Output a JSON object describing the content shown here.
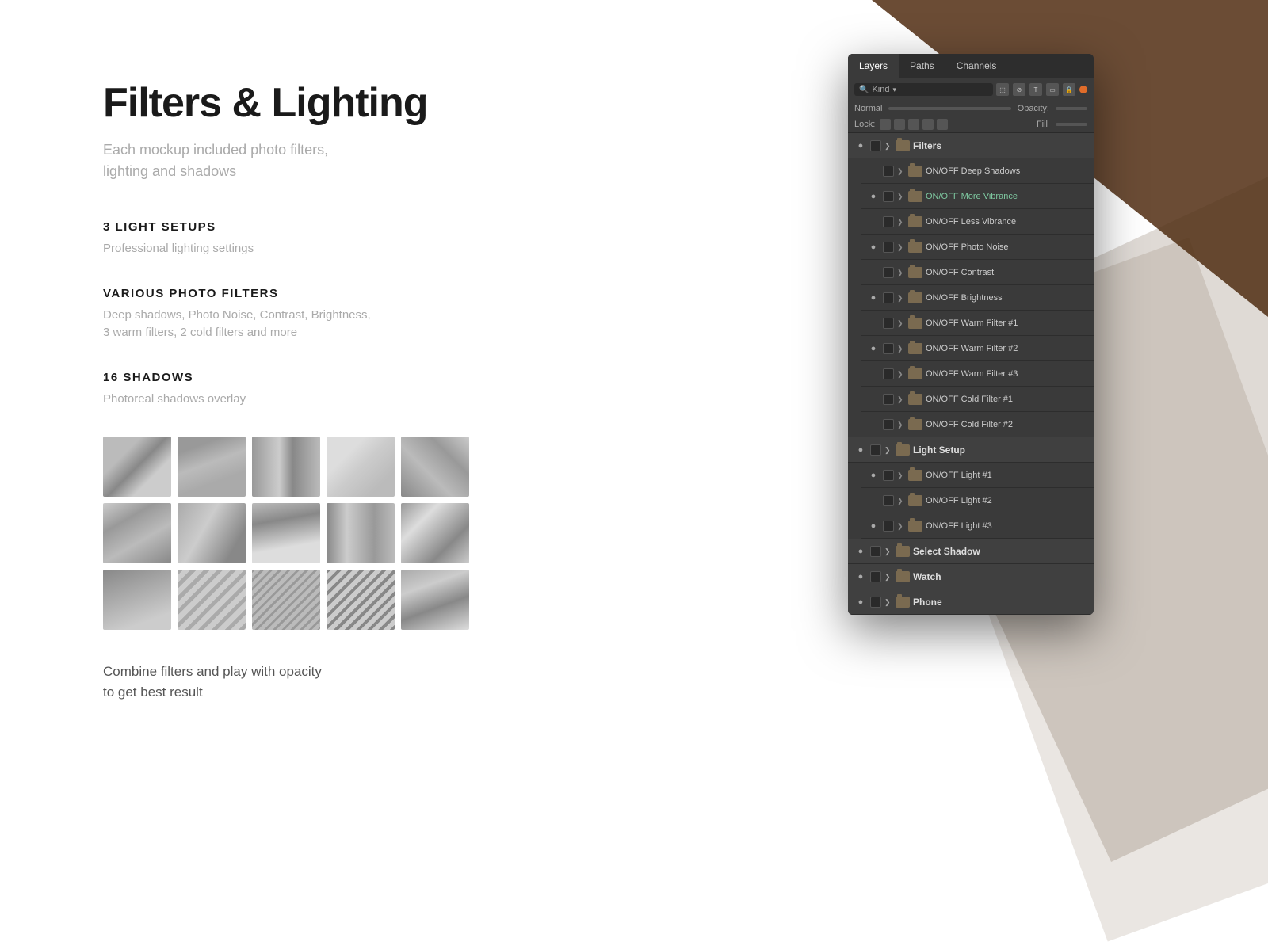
{
  "background": {
    "corner_color": "#6b4c35"
  },
  "left_content": {
    "title": "Filters & Lighting",
    "subtitle_line1": "Each mockup included photo filters,",
    "subtitle_line2": "lighting and shadows",
    "sections": [
      {
        "id": "light-setups",
        "title": "3 LIGHT SETUPS",
        "description": "Professional lighting settings"
      },
      {
        "id": "photo-filters",
        "title": "VARIOUS PHOTO FILTERS",
        "description_line1": "Deep shadows, Photo Noise, Contrast, Brightness,",
        "description_line2": "3 warm filters, 2 cold filters and more"
      },
      {
        "id": "shadows",
        "title": "16 SHADOWS",
        "description": "Photoreal shadows overlay"
      }
    ],
    "bottom_text_line1": "Combine filters and play with opacity",
    "bottom_text_line2": "to get best result"
  },
  "ps_panel": {
    "tabs": [
      "Layers",
      "Paths",
      "Channels"
    ],
    "active_tab": "Layers",
    "search_placeholder": "Kind",
    "blend_mode": "Normal",
    "opacity_label": "Opacity:",
    "lock_label": "Lock:",
    "fill_label": "Fill",
    "layers": [
      {
        "id": "filters-group",
        "type": "group",
        "visible": true,
        "expanded": true,
        "name": "Filters",
        "indent": 0
      },
      {
        "id": "deep-shadows",
        "type": "layer",
        "visible": false,
        "name": "ON/OFF Deep Shadows",
        "indent": 1
      },
      {
        "id": "more-vibrance",
        "type": "layer",
        "visible": true,
        "name": "ON/OFF More Vibrance",
        "name_colored": true,
        "indent": 1
      },
      {
        "id": "less-vibrance",
        "type": "layer",
        "visible": false,
        "name": "ON/OFF Less Vibrance",
        "indent": 1
      },
      {
        "id": "photo-noise",
        "type": "layer",
        "visible": true,
        "name": "ON/OFF Photo Noise",
        "indent": 1
      },
      {
        "id": "contrast",
        "type": "layer",
        "visible": false,
        "name": "ON/OFF Contrast",
        "indent": 1
      },
      {
        "id": "brightness",
        "type": "layer",
        "visible": true,
        "name": "ON/OFF Brightness",
        "indent": 1
      },
      {
        "id": "warm-1",
        "type": "layer",
        "visible": false,
        "name": "ON/OFF Warm Filter #1",
        "indent": 1
      },
      {
        "id": "warm-2",
        "type": "layer",
        "visible": true,
        "name": "ON/OFF Warm Filter #2",
        "indent": 1
      },
      {
        "id": "warm-3",
        "type": "layer",
        "visible": false,
        "name": "ON/OFF Warm Filter #3",
        "indent": 1
      },
      {
        "id": "cold-1",
        "type": "layer",
        "visible": false,
        "name": "ON/OFF Cold Filter #1",
        "indent": 1
      },
      {
        "id": "cold-2",
        "type": "layer",
        "visible": false,
        "name": "ON/OFF Cold Filter #2",
        "indent": 1
      },
      {
        "id": "light-setup-group",
        "type": "group",
        "visible": true,
        "expanded": true,
        "name": "Light Setup",
        "indent": 0
      },
      {
        "id": "light-1",
        "type": "layer",
        "visible": true,
        "name": "ON/OFF Light #1",
        "indent": 1
      },
      {
        "id": "light-2",
        "type": "layer",
        "visible": false,
        "name": "ON/OFF Light #2",
        "indent": 1
      },
      {
        "id": "light-3",
        "type": "layer",
        "visible": true,
        "name": "ON/OFF Light #3",
        "indent": 1
      },
      {
        "id": "select-shadow-group",
        "type": "group",
        "visible": true,
        "expanded": false,
        "name": "Select Shadow",
        "indent": 0
      },
      {
        "id": "watch-group",
        "type": "group",
        "visible": true,
        "expanded": false,
        "name": "Watch",
        "indent": 0
      },
      {
        "id": "phone-group",
        "type": "group",
        "visible": true,
        "expanded": false,
        "name": "Phone",
        "indent": 0
      }
    ]
  }
}
